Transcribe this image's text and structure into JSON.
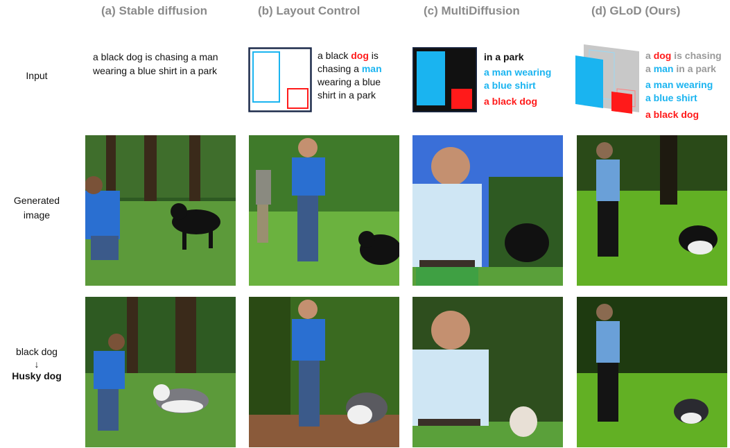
{
  "columns": [
    {
      "label": "(a) Stable diffusion"
    },
    {
      "label": "(b) Layout Control"
    },
    {
      "label": "(c) MultiDiffusion"
    },
    {
      "label": "(d) GLoD (Ours)"
    }
  ],
  "rows": {
    "input": "Input",
    "generated_line1": "Generated",
    "generated_line2": "image",
    "edit_from": "black dog",
    "edit_arrow": "↓",
    "edit_to": "Husky dog"
  },
  "inputs": {
    "sd_prompt_line1": "a black dog is chasing a man",
    "sd_prompt_line2": "wearing a blue shirt in a park",
    "lc": {
      "l1a": "a black ",
      "l1b": "dog",
      "l1c": " is",
      "l2a": "chasing a ",
      "l2b": "man",
      "l3": "wearing a blue",
      "l4": "shirt in a park"
    },
    "md": {
      "park": "in a park",
      "man1": "a man wearing",
      "man2": "a blue shirt",
      "dog": "a black dog"
    },
    "glod": {
      "l1a": "a ",
      "l1b": "dog",
      "l1c": " is chasing",
      "l2a": "a ",
      "l2b": "man",
      "l2c": " in a park",
      "man1": "a man wearing",
      "man2": "a blue shirt",
      "dog": "a black dog"
    }
  },
  "colors": {
    "red": "#ff1a1a",
    "blue": "#1ab4f0",
    "gray": "#9a9a9a",
    "grass": "#4f8f2e",
    "shirt": "#2a6fd1"
  }
}
